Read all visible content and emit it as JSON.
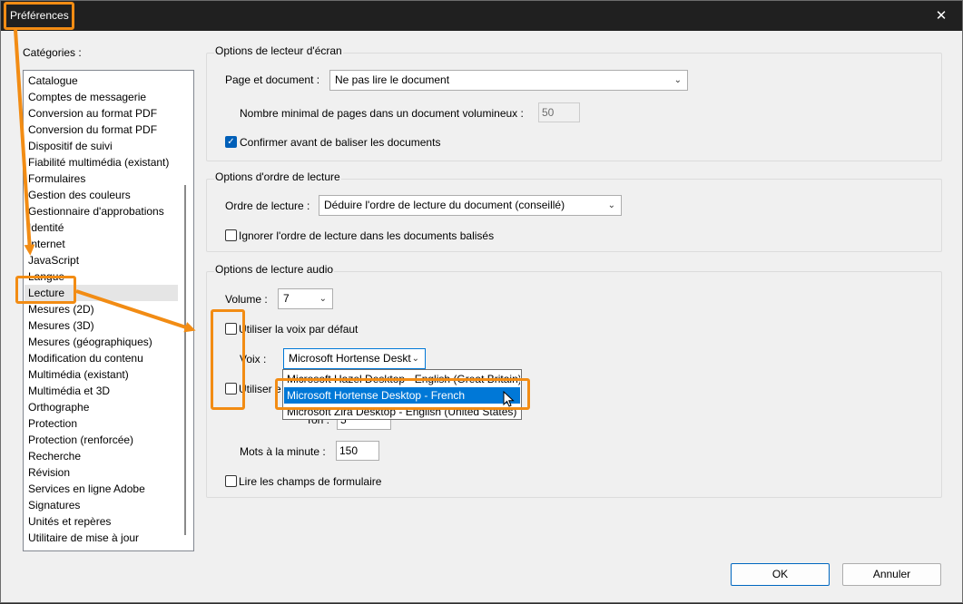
{
  "window": {
    "title": "Préférences",
    "close_glyph": "✕"
  },
  "categories": {
    "label": "Catégories :",
    "items": [
      "Catalogue",
      "Comptes de messagerie",
      "Conversion au format PDF",
      "Conversion du format PDF",
      "Dispositif de suivi",
      "Fiabilité multimédia (existant)",
      "Formulaires",
      "Gestion des couleurs",
      "Gestionnaire d'approbations",
      "Identité",
      "Internet",
      "JavaScript",
      "Langue",
      "Lecture",
      "Mesures (2D)",
      "Mesures (3D)",
      "Mesures (géographiques)",
      "Modification du contenu",
      "Multimédia (existant)",
      "Multimédia et 3D",
      "Orthographe",
      "Protection",
      "Protection (renforcée)",
      "Recherche",
      "Révision",
      "Services en ligne Adobe",
      "Signatures",
      "Unités et repères",
      "Utilitaire de mise à jour"
    ],
    "selected_index": 13
  },
  "screen_reader": {
    "title": "Options de lecteur d'écran",
    "page_doc_label": "Page et document :",
    "page_doc_value": "Ne pas lire le document",
    "min_pages_label": "Nombre minimal de pages dans un document volumineux :",
    "min_pages_value": "50",
    "confirm_label": "Confirmer avant de baliser les documents",
    "confirm_checked": true
  },
  "reading_order": {
    "title": "Options d'ordre de lecture",
    "order_label": "Ordre de lecture :",
    "order_value": "Déduire l'ordre de lecture du document (conseillé)",
    "ignore_label": "Ignorer l'ordre de lecture dans les documents balisés",
    "ignore_checked": false
  },
  "audio": {
    "title": "Options de lecture audio",
    "volume_label": "Volume :",
    "volume_value": "7",
    "default_voice_label": "Utiliser la voix par défaut",
    "voice_label": "Voix :",
    "voice_value": "Microsoft Hortense Deskt",
    "voice_options": [
      "Microsoft Hazel Desktop - English (Great Britain)",
      "Microsoft Hortense Desktop - French",
      "Microsoft Zira Desktop - English (United States)"
    ],
    "voice_selected_index": 1,
    "use_partial_label": "Utiliser e",
    "tone_partial_label": "Ton :",
    "tone_value": "5",
    "words_label": "Mots à la minute :",
    "words_value": "150",
    "read_fields_label": "Lire les champs de formulaire"
  },
  "buttons": {
    "ok": "OK",
    "cancel": "Annuler"
  },
  "colors": {
    "highlight": "#f28c14",
    "selection": "#0078d7",
    "titlebar": "#202020"
  }
}
